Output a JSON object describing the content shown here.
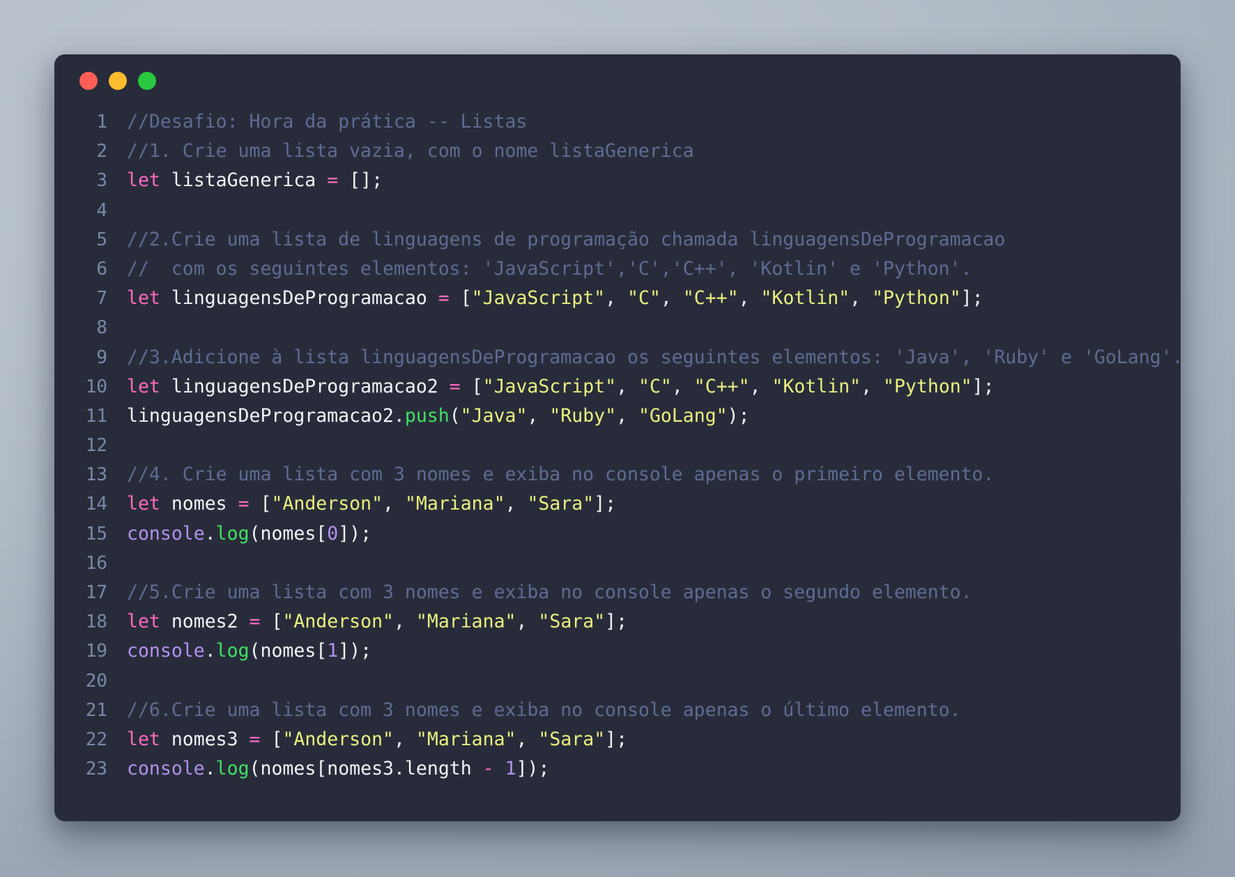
{
  "window": {
    "traffic_lights": [
      {
        "name": "close-button",
        "color": "#ff5f56"
      },
      {
        "name": "minimize-button",
        "color": "#ffbd2e"
      },
      {
        "name": "maximize-button",
        "color": "#28c840"
      }
    ],
    "background": "#282c3a"
  },
  "theme": {
    "comment": "#5f6b93",
    "keyword": "#ff6ac1",
    "identifier": "#f2f4f8",
    "string": "#e9f07f",
    "function": "#42e066",
    "builtin": "#b292f0",
    "number": "#b292f0",
    "operator": "#ff6ac1",
    "line_number": "#7a88a8",
    "desktop_gradient_from": "#c0c8d2",
    "desktop_gradient_to": "#8c98a6"
  },
  "editor": {
    "language": "javascript",
    "line_numbers": [
      "1",
      "2",
      "3",
      "4",
      "5",
      "6",
      "7",
      "8",
      "9",
      "10",
      "11",
      "12",
      "13",
      "14",
      "15",
      "16",
      "17",
      "18",
      "19",
      "20",
      "21",
      "22",
      "23"
    ],
    "lines": [
      {
        "n": "1",
        "text": "//Desafio: Hora da prática -- Listas",
        "tokens": [
          {
            "t": "//Desafio: Hora da prática -- Listas",
            "c": "comment"
          }
        ]
      },
      {
        "n": "2",
        "text": "//1. Crie uma lista vazia, com o nome listaGenerica",
        "tokens": [
          {
            "t": "//1. Crie uma lista vazia, com o nome listaGenerica",
            "c": "comment"
          }
        ]
      },
      {
        "n": "3",
        "text": "let listaGenerica = [];",
        "tokens": [
          {
            "t": "let",
            "c": "keyword"
          },
          {
            "t": " ",
            "c": "punct"
          },
          {
            "t": "listaGenerica",
            "c": "ident"
          },
          {
            "t": " ",
            "c": "punct"
          },
          {
            "t": "=",
            "c": "op"
          },
          {
            "t": " ",
            "c": "punct"
          },
          {
            "t": "[];",
            "c": "punct"
          }
        ]
      },
      {
        "n": "4",
        "text": "",
        "tokens": []
      },
      {
        "n": "5",
        "text": "//2.Crie uma lista de linguagens de programação chamada linguagensDeProgramacao",
        "tokens": [
          {
            "t": "//2.Crie uma lista de linguagens de programação chamada linguagensDeProgramacao",
            "c": "comment"
          }
        ]
      },
      {
        "n": "6",
        "text": "//  com os seguintes elementos: 'JavaScript','C','C++', 'Kotlin' e 'Python'.",
        "tokens": [
          {
            "t": "//  com os seguintes elementos: 'JavaScript','C','C++', 'Kotlin' e 'Python'.",
            "c": "comment"
          }
        ]
      },
      {
        "n": "7",
        "text": "let linguagensDeProgramacao = [\"JavaScript\", \"C\", \"C++\", \"Kotlin\", \"Python\"];",
        "tokens": [
          {
            "t": "let",
            "c": "keyword"
          },
          {
            "t": " ",
            "c": "punct"
          },
          {
            "t": "linguagensDeProgramacao",
            "c": "ident"
          },
          {
            "t": " ",
            "c": "punct"
          },
          {
            "t": "=",
            "c": "op"
          },
          {
            "t": " [",
            "c": "punct"
          },
          {
            "t": "\"JavaScript\"",
            "c": "string"
          },
          {
            "t": ", ",
            "c": "punct"
          },
          {
            "t": "\"C\"",
            "c": "string"
          },
          {
            "t": ", ",
            "c": "punct"
          },
          {
            "t": "\"C++\"",
            "c": "string"
          },
          {
            "t": ", ",
            "c": "punct"
          },
          {
            "t": "\"Kotlin\"",
            "c": "string"
          },
          {
            "t": ", ",
            "c": "punct"
          },
          {
            "t": "\"Python\"",
            "c": "string"
          },
          {
            "t": "];",
            "c": "punct"
          }
        ]
      },
      {
        "n": "8",
        "text": "",
        "tokens": []
      },
      {
        "n": "9",
        "text": "//3.Adicione à lista linguagensDeProgramacao os seguintes elementos: 'Java', 'Ruby' e 'GoLang'.",
        "tokens": [
          {
            "t": "//3.Adicione à lista linguagensDeProgramacao os seguintes elementos: 'Java', 'Ruby' e 'GoLang'.",
            "c": "comment"
          }
        ]
      },
      {
        "n": "10",
        "text": "let linguagensDeProgramacao2 = [\"JavaScript\", \"C\", \"C++\", \"Kotlin\", \"Python\"];",
        "tokens": [
          {
            "t": "let",
            "c": "keyword"
          },
          {
            "t": " ",
            "c": "punct"
          },
          {
            "t": "linguagensDeProgramacao2",
            "c": "ident"
          },
          {
            "t": " ",
            "c": "punct"
          },
          {
            "t": "=",
            "c": "op"
          },
          {
            "t": " [",
            "c": "punct"
          },
          {
            "t": "\"JavaScript\"",
            "c": "string"
          },
          {
            "t": ", ",
            "c": "punct"
          },
          {
            "t": "\"C\"",
            "c": "string"
          },
          {
            "t": ", ",
            "c": "punct"
          },
          {
            "t": "\"C++\"",
            "c": "string"
          },
          {
            "t": ", ",
            "c": "punct"
          },
          {
            "t": "\"Kotlin\"",
            "c": "string"
          },
          {
            "t": ", ",
            "c": "punct"
          },
          {
            "t": "\"Python\"",
            "c": "string"
          },
          {
            "t": "];",
            "c": "punct"
          }
        ]
      },
      {
        "n": "11",
        "text": "linguagensDeProgramacao2.push(\"Java\", \"Ruby\", \"GoLang\");",
        "tokens": [
          {
            "t": "linguagensDeProgramacao2",
            "c": "ident"
          },
          {
            "t": ".",
            "c": "punct"
          },
          {
            "t": "push",
            "c": "func"
          },
          {
            "t": "(",
            "c": "punct"
          },
          {
            "t": "\"Java\"",
            "c": "string"
          },
          {
            "t": ", ",
            "c": "punct"
          },
          {
            "t": "\"Ruby\"",
            "c": "string"
          },
          {
            "t": ", ",
            "c": "punct"
          },
          {
            "t": "\"GoLang\"",
            "c": "string"
          },
          {
            "t": ");",
            "c": "punct"
          }
        ]
      },
      {
        "n": "12",
        "text": "",
        "tokens": []
      },
      {
        "n": "13",
        "text": "//4. Crie uma lista com 3 nomes e exiba no console apenas o primeiro elemento.",
        "tokens": [
          {
            "t": "//4. Crie uma lista com 3 nomes e exiba no console apenas o primeiro elemento.",
            "c": "comment"
          }
        ]
      },
      {
        "n": "14",
        "text": "let nomes = [\"Anderson\", \"Mariana\", \"Sara\"];",
        "tokens": [
          {
            "t": "let",
            "c": "keyword"
          },
          {
            "t": " ",
            "c": "punct"
          },
          {
            "t": "nomes",
            "c": "ident"
          },
          {
            "t": " ",
            "c": "punct"
          },
          {
            "t": "=",
            "c": "op"
          },
          {
            "t": " [",
            "c": "punct"
          },
          {
            "t": "\"Anderson\"",
            "c": "string"
          },
          {
            "t": ", ",
            "c": "punct"
          },
          {
            "t": "\"Mariana\"",
            "c": "string"
          },
          {
            "t": ", ",
            "c": "punct"
          },
          {
            "t": "\"Sara\"",
            "c": "string"
          },
          {
            "t": "];",
            "c": "punct"
          }
        ]
      },
      {
        "n": "15",
        "text": "console.log(nomes[0]);",
        "tokens": [
          {
            "t": "console",
            "c": "builtin"
          },
          {
            "t": ".",
            "c": "punct"
          },
          {
            "t": "log",
            "c": "func"
          },
          {
            "t": "(",
            "c": "punct"
          },
          {
            "t": "nomes",
            "c": "ident"
          },
          {
            "t": "[",
            "c": "punct"
          },
          {
            "t": "0",
            "c": "number"
          },
          {
            "t": "]);",
            "c": "punct"
          }
        ]
      },
      {
        "n": "16",
        "text": "",
        "tokens": []
      },
      {
        "n": "17",
        "text": "//5.Crie uma lista com 3 nomes e exiba no console apenas o segundo elemento.",
        "tokens": [
          {
            "t": "//5.Crie uma lista com 3 nomes e exiba no console apenas o segundo elemento.",
            "c": "comment"
          }
        ]
      },
      {
        "n": "18",
        "text": "let nomes2 = [\"Anderson\", \"Mariana\", \"Sara\"];",
        "tokens": [
          {
            "t": "let",
            "c": "keyword"
          },
          {
            "t": " ",
            "c": "punct"
          },
          {
            "t": "nomes2",
            "c": "ident"
          },
          {
            "t": " ",
            "c": "punct"
          },
          {
            "t": "=",
            "c": "op"
          },
          {
            "t": " [",
            "c": "punct"
          },
          {
            "t": "\"Anderson\"",
            "c": "string"
          },
          {
            "t": ", ",
            "c": "punct"
          },
          {
            "t": "\"Mariana\"",
            "c": "string"
          },
          {
            "t": ", ",
            "c": "punct"
          },
          {
            "t": "\"Sara\"",
            "c": "string"
          },
          {
            "t": "];",
            "c": "punct"
          }
        ]
      },
      {
        "n": "19",
        "text": "console.log(nomes[1]);",
        "tokens": [
          {
            "t": "console",
            "c": "builtin"
          },
          {
            "t": ".",
            "c": "punct"
          },
          {
            "t": "log",
            "c": "func"
          },
          {
            "t": "(",
            "c": "punct"
          },
          {
            "t": "nomes",
            "c": "ident"
          },
          {
            "t": "[",
            "c": "punct"
          },
          {
            "t": "1",
            "c": "number"
          },
          {
            "t": "]);",
            "c": "punct"
          }
        ]
      },
      {
        "n": "20",
        "text": "",
        "tokens": []
      },
      {
        "n": "21",
        "text": "//6.Crie uma lista com 3 nomes e exiba no console apenas o último elemento.",
        "tokens": [
          {
            "t": "//6.Crie uma lista com 3 nomes e exiba no console apenas o último elemento.",
            "c": "comment"
          }
        ]
      },
      {
        "n": "22",
        "text": "let nomes3 = [\"Anderson\", \"Mariana\", \"Sara\"];",
        "tokens": [
          {
            "t": "let",
            "c": "keyword"
          },
          {
            "t": " ",
            "c": "punct"
          },
          {
            "t": "nomes3",
            "c": "ident"
          },
          {
            "t": " ",
            "c": "punct"
          },
          {
            "t": "=",
            "c": "op"
          },
          {
            "t": " [",
            "c": "punct"
          },
          {
            "t": "\"Anderson\"",
            "c": "string"
          },
          {
            "t": ", ",
            "c": "punct"
          },
          {
            "t": "\"Mariana\"",
            "c": "string"
          },
          {
            "t": ", ",
            "c": "punct"
          },
          {
            "t": "\"Sara\"",
            "c": "string"
          },
          {
            "t": "];",
            "c": "punct"
          }
        ]
      },
      {
        "n": "23",
        "text": "console.log(nomes[nomes3.length - 1]);",
        "tokens": [
          {
            "t": "console",
            "c": "builtin"
          },
          {
            "t": ".",
            "c": "punct"
          },
          {
            "t": "log",
            "c": "func"
          },
          {
            "t": "(",
            "c": "punct"
          },
          {
            "t": "nomes",
            "c": "ident"
          },
          {
            "t": "[",
            "c": "punct"
          },
          {
            "t": "nomes3",
            "c": "ident"
          },
          {
            "t": ".",
            "c": "punct"
          },
          {
            "t": "length",
            "c": "ident"
          },
          {
            "t": " ",
            "c": "punct"
          },
          {
            "t": "-",
            "c": "op"
          },
          {
            "t": " ",
            "c": "punct"
          },
          {
            "t": "1",
            "c": "number"
          },
          {
            "t": "]);",
            "c": "punct"
          }
        ]
      }
    ]
  }
}
